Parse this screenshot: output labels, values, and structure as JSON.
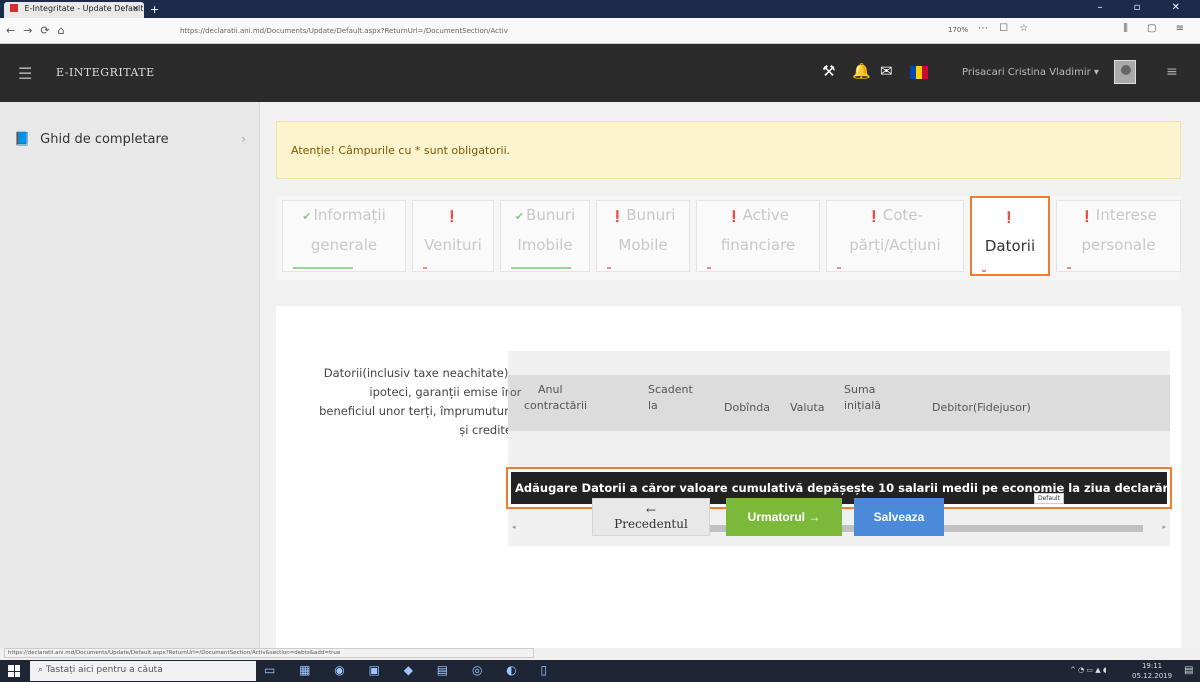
{
  "browser": {
    "tab_title": "E-Integritate - Update Default",
    "tab_close": "✕",
    "new_tab": "+",
    "url": "https://declaratii.ani.md/Documents/Update/Default.aspx?ReturnUrl=/DocumentSection/Activ",
    "zoom": "170%",
    "window_controls": "–  ▫  ✕"
  },
  "header": {
    "brand": "E-INTEGRITATE",
    "username": "Prisacari Cristina Vladimir ▾"
  },
  "sidebar": {
    "items": [
      {
        "label": "Ghid de completare",
        "chevron": "›"
      }
    ]
  },
  "alert": {
    "text": "Atenție! Câmpurile cu * sunt obligatorii."
  },
  "steps": [
    {
      "line1": "Informații",
      "line2": "generale",
      "status": "ok"
    },
    {
      "line1": "",
      "line2": "Venituri",
      "status": "err"
    },
    {
      "line1": "Bunuri",
      "line2": "Imobile",
      "status": "ok"
    },
    {
      "line1": "Bunuri",
      "line2": "Mobile",
      "status": "err"
    },
    {
      "line1": "Active",
      "line2": "financiare",
      "status": "err"
    },
    {
      "line1": "Cote-",
      "line2": "părți/Acțiuni",
      "status": "err"
    },
    {
      "line1": "",
      "line2": "Datorii",
      "status": "err",
      "active": true
    },
    {
      "line1": "Interese",
      "line2": "personale",
      "status": "err"
    }
  ],
  "form": {
    "field_label": "Datorii(inclusiv taxe neachitate), ipoteci, garanții emise în beneficiul unor terți, împrumuturi și credite",
    "columns": [
      {
        "line1": "",
        "line2": "or"
      },
      {
        "line1": "Anul",
        "line2": "contractării"
      },
      {
        "line1": "Scadent",
        "line2": "la"
      },
      {
        "line1": "",
        "line2": "Dobînda"
      },
      {
        "line1": "",
        "line2": "Valuta"
      },
      {
        "line1": "Suma",
        "line2": "inițială"
      },
      {
        "line1": "",
        "line2": "Debitor(Fidejusor)"
      }
    ],
    "add_button": "Adăugare Datorii a căror valoare cumulativă depășește 10 salarii medii pe economie la ziua declarării",
    "tooltip": "Default"
  },
  "nav": {
    "prev": "← Precedentul",
    "next": "Urmatorul →",
    "save": "Salveaza"
  },
  "status_url": "https://declaratii.ani.md/Documents/Update/Default.aspx?ReturnUrl=/DocumentSection/Activ&section=debts&add=true",
  "taskbar": {
    "search_placeholder": "Tastați aici pentru a căuta",
    "time": "19:11",
    "date": "05.12.2019"
  },
  "colors": {
    "active_outline": "#ef7d2f",
    "next_button": "#7cb93a",
    "save_button": "#4a8ad8",
    "header_bg": "#2b2b2b"
  }
}
